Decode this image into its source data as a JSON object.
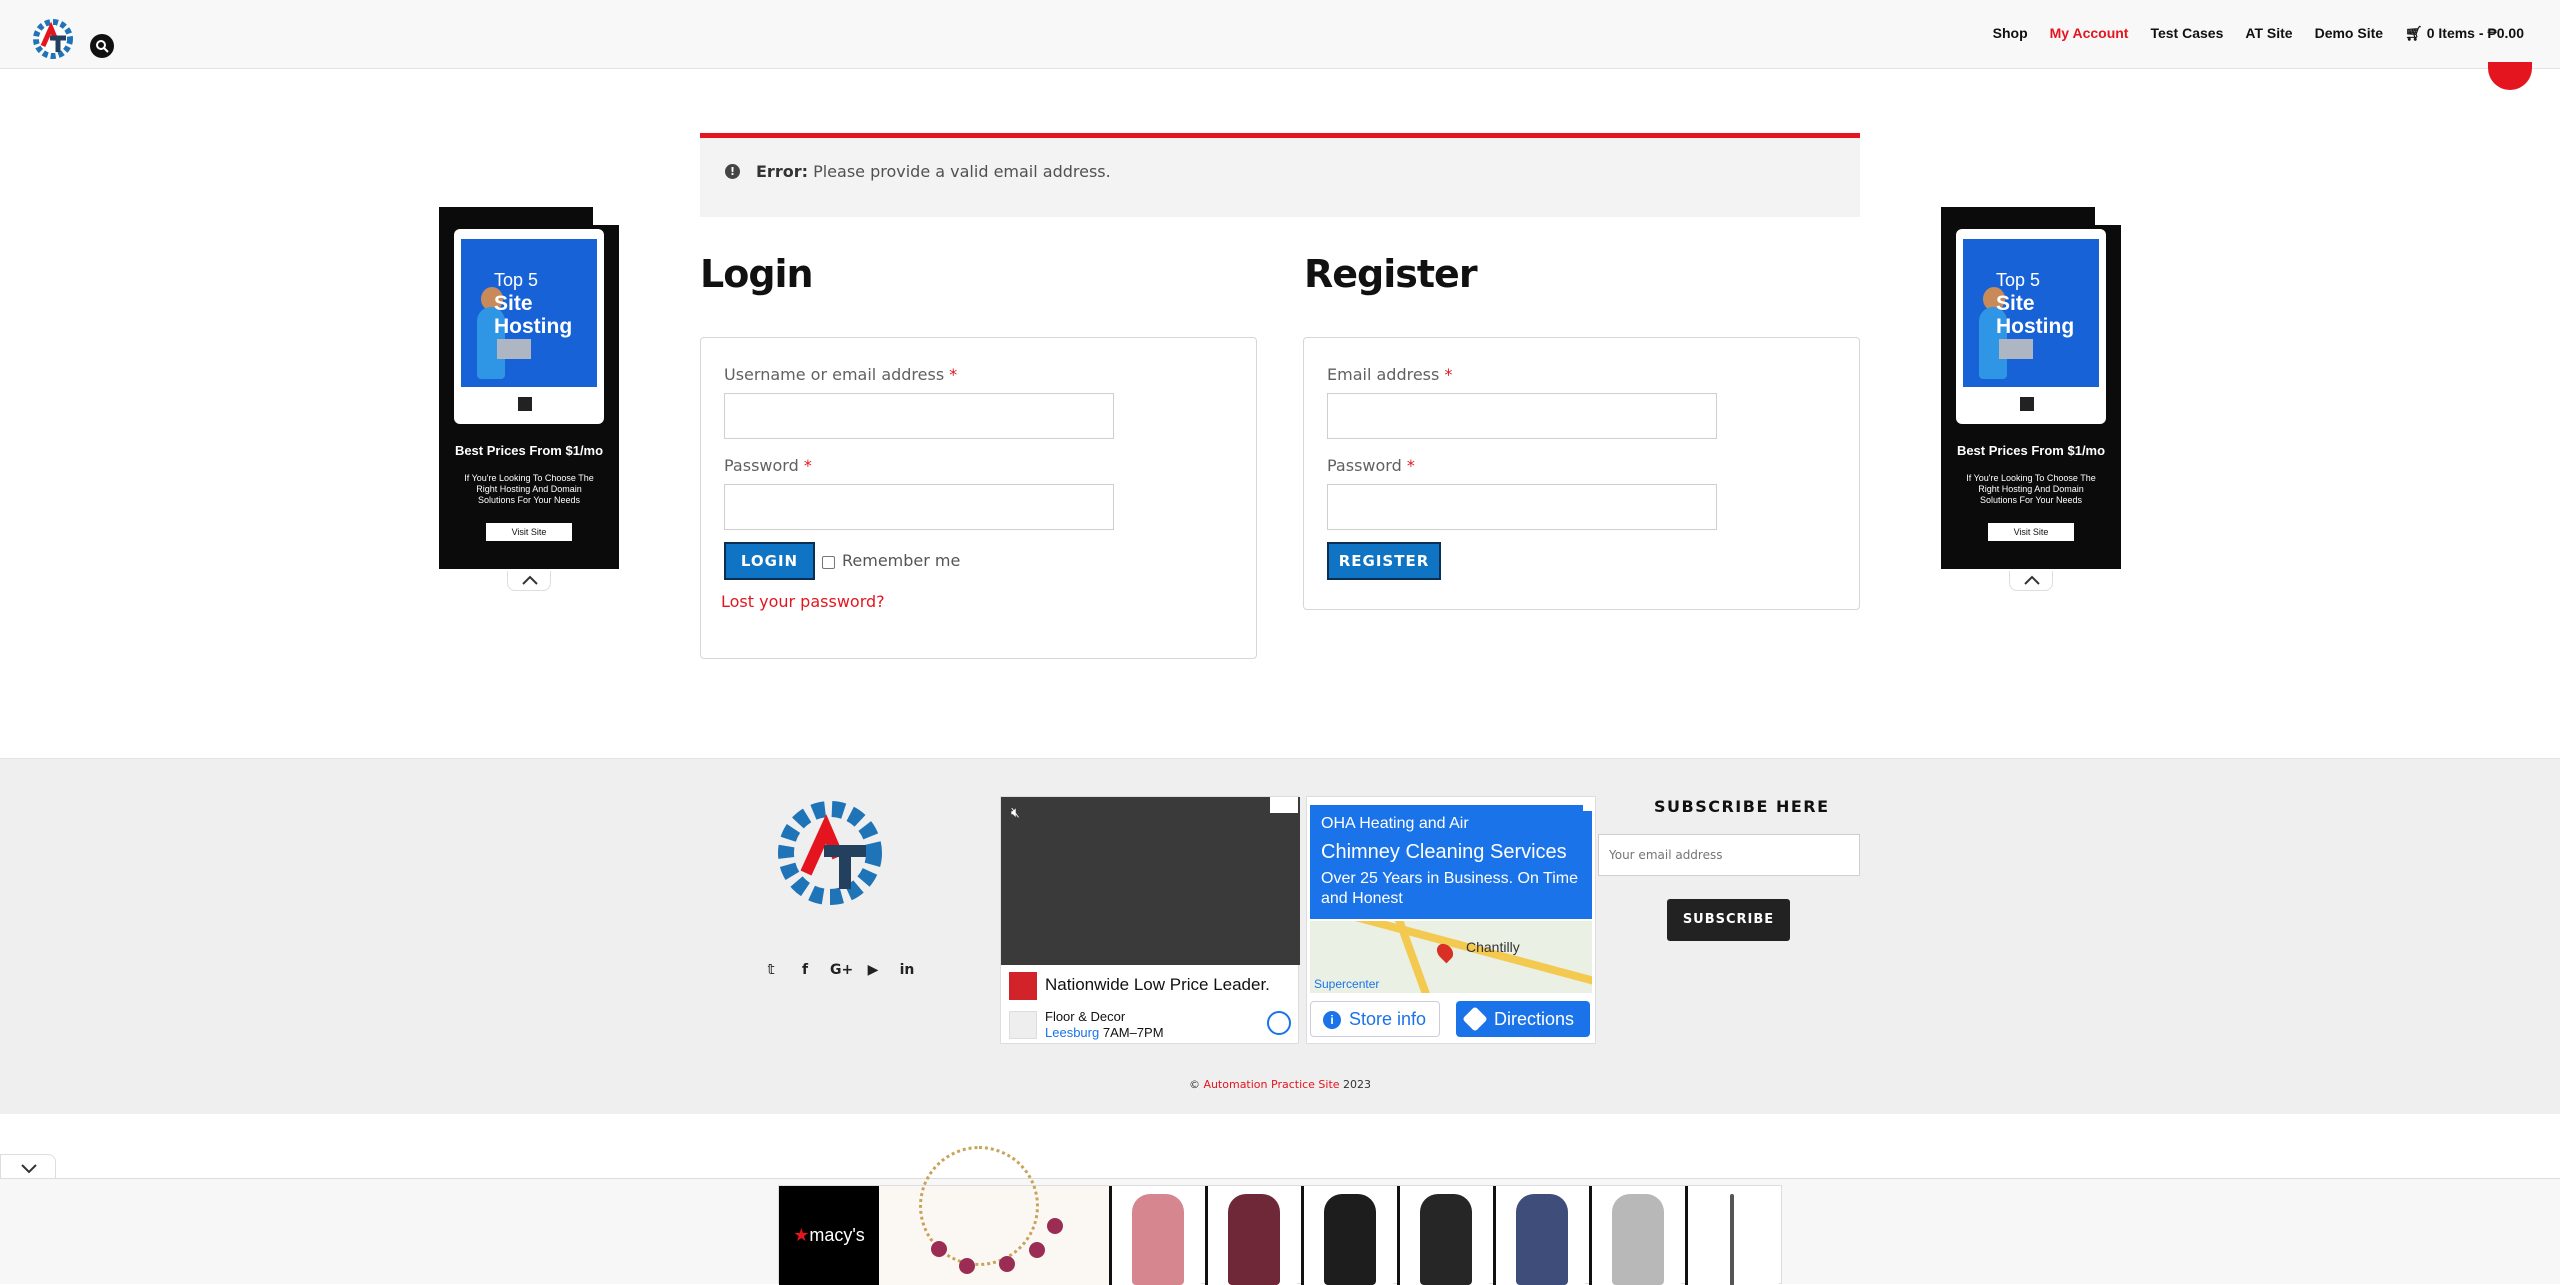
{
  "header": {
    "logo_name": "AT logo",
    "nav": [
      {
        "label": "Shop",
        "active": false
      },
      {
        "label": "My Account",
        "active": true
      },
      {
        "label": "Test Cases",
        "active": false
      },
      {
        "label": "AT Site",
        "active": false
      },
      {
        "label": "Demo Site",
        "active": false
      }
    ],
    "cart": "0 Items - ₱0.00"
  },
  "notice": {
    "icon": "!",
    "label": "Error:",
    "message": " Please provide a valid email address."
  },
  "side_ad": {
    "top": "Top 5",
    "headline1": "Site",
    "headline2": "Hosting",
    "price": "Best Prices From $1/mo",
    "sub": "If You're Looking To Choose The Right Hosting And Domain Solutions For Your Needs",
    "cta": "Visit Site"
  },
  "login": {
    "title": "Login",
    "username_label": "Username or email address",
    "password_label": "Password",
    "required": "*",
    "button": "LOGIN",
    "remember": "Remember me",
    "lost": "Lost your password?"
  },
  "register": {
    "title": "Register",
    "email_label": "Email address",
    "password_label": "Password",
    "required": "*",
    "button": "REGISTER"
  },
  "footer": {
    "social": [
      "𝕥",
      "f",
      "G+",
      "▶",
      "in"
    ],
    "video_ad": {
      "headline": "Nationwide Low Price Leader.",
      "store_name": "Floor & Decor",
      "store_city": "Leesburg",
      "store_hours": "7AM–7PM"
    },
    "local_ad": {
      "business": "OHA Heating and Air",
      "service": "Chimney Cleaning Services",
      "desc": "Over 25 Years in Business. On Time and Honest",
      "place": "Chantilly",
      "place2": "Supercenter",
      "store_info": "Store info",
      "directions": "Directions"
    },
    "subscribe_title": "SUBSCRIBE HERE",
    "subscribe_placeholder": "Your email address",
    "subscribe_button": "SUBSCRIBE",
    "copyright_prefix": "© ",
    "copyright_link": "Automation Practice Site",
    "copyright_year": " 2023"
  },
  "bottom_ad": {
    "brand": "macy's"
  },
  "colors": {
    "accent": "#e4151f",
    "button_blue": "#0f74c3",
    "ad_blue": "#1a73e8"
  }
}
